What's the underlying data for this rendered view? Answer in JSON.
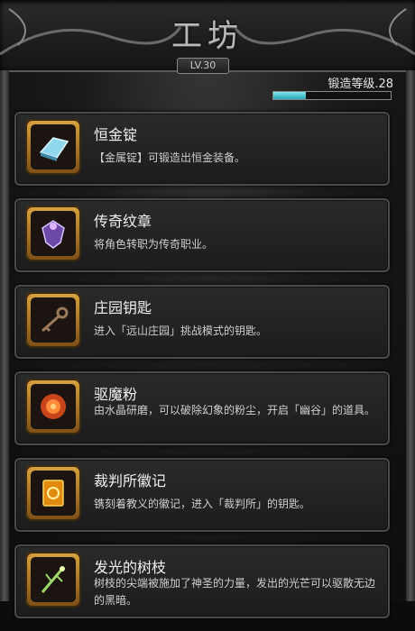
{
  "header": {
    "title": "工坊",
    "level": "LV.30"
  },
  "forge": {
    "label": "锻造等级.28",
    "progress": 0.28
  },
  "items": [
    {
      "name": "恒金锭",
      "desc": "【金属锭】可锻造出恒金装备。",
      "icon": "metal-ingot-icon"
    },
    {
      "name": "传奇纹章",
      "desc": "将角色转职为传奇职业。",
      "icon": "legend-crest-icon"
    },
    {
      "name": "庄园钥匙",
      "desc": "进入「远山庄园」挑战模式的钥匙。",
      "icon": "key-icon"
    },
    {
      "name": "驱魔粉",
      "desc": "由水晶研磨，可以破除幻象的粉尘，开启「幽谷」的道具。",
      "icon": "exorcism-powder-icon"
    },
    {
      "name": "裁判所徽记",
      "desc": "镌刻着教义的徽记，进入「裁判所」的钥匙。",
      "icon": "tribunal-emblem-icon"
    },
    {
      "name": "发光的树枝",
      "desc": "树枝的尖端被施加了神圣的力量，发出的光芒可以驱散无边的黑暗。",
      "icon": "glowing-branch-icon"
    }
  ]
}
